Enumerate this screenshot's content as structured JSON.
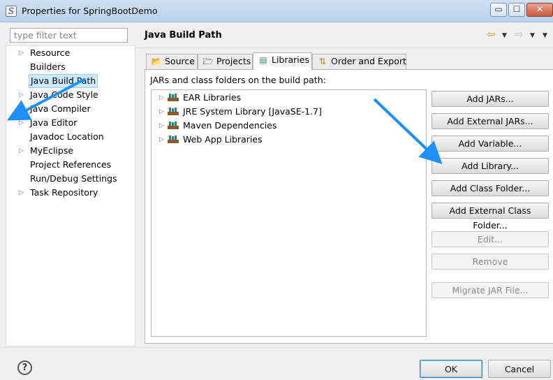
{
  "window": {
    "title": "Properties for SpringBootDemo",
    "minimize": "▭",
    "maximize": "☐",
    "close": "✕",
    "icon": "spring-app-icon",
    "app_letter": "S"
  },
  "filter": {
    "placeholder": "type filter text",
    "value": ""
  },
  "nav": {
    "items": [
      {
        "label": "Resource",
        "expandable": true
      },
      {
        "label": "Builders",
        "expandable": false
      },
      {
        "label": "Java Build Path",
        "expandable": false,
        "selected": true
      },
      {
        "label": "Java Code Style",
        "expandable": true
      },
      {
        "label": "Java Compiler",
        "expandable": true
      },
      {
        "label": "Java Editor",
        "expandable": true
      },
      {
        "label": "Javadoc Location",
        "expandable": false
      },
      {
        "label": "MyEclipse",
        "expandable": true
      },
      {
        "label": "Project References",
        "expandable": false
      },
      {
        "label": "Run/Debug Settings",
        "expandable": false
      },
      {
        "label": "Task Repository",
        "expandable": true
      }
    ],
    "expander_glyph": "▷"
  },
  "header": {
    "title": "Java Build Path",
    "back_glyph": "⇦",
    "forward_glyph": "⇨",
    "dropdown_glyph": "▼"
  },
  "tabs": [
    {
      "label": "Source",
      "icon": "source-folder-icon",
      "glyph": "📂"
    },
    {
      "label": "Projects",
      "icon": "projects-icon",
      "glyph": "🗁"
    },
    {
      "label": "Libraries",
      "icon": "libraries-icon",
      "glyph": "▤",
      "active": true
    },
    {
      "label": "Order and Export",
      "icon": "order-export-icon",
      "glyph": "⇅"
    }
  ],
  "libraries": {
    "label": "JARs and class folders on the build path:",
    "items": [
      {
        "label": "EAR Libraries"
      },
      {
        "label": "JRE System Library [JavaSE-1.7]"
      },
      {
        "label": "Maven Dependencies"
      },
      {
        "label": "Web App Libraries"
      }
    ]
  },
  "buttons": {
    "add_jars": "Add JARs...",
    "add_external_jars": "Add External JARs...",
    "add_variable": "Add Variable...",
    "add_library": "Add Library...",
    "add_class_folder": "Add Class Folder...",
    "add_external_class_folder": "Add External Class Folder...",
    "edit": "Edit...",
    "remove": "Remove",
    "migrate_jar": "Migrate JAR File..."
  },
  "footer": {
    "help": "?",
    "ok": "OK",
    "cancel": "Cancel"
  },
  "colors": {
    "selection": "#cce8ff",
    "annotation_arrow": "#1e90ff",
    "library_icon_green": "#2e8b57",
    "library_icon_brown": "#8b5a2b"
  }
}
